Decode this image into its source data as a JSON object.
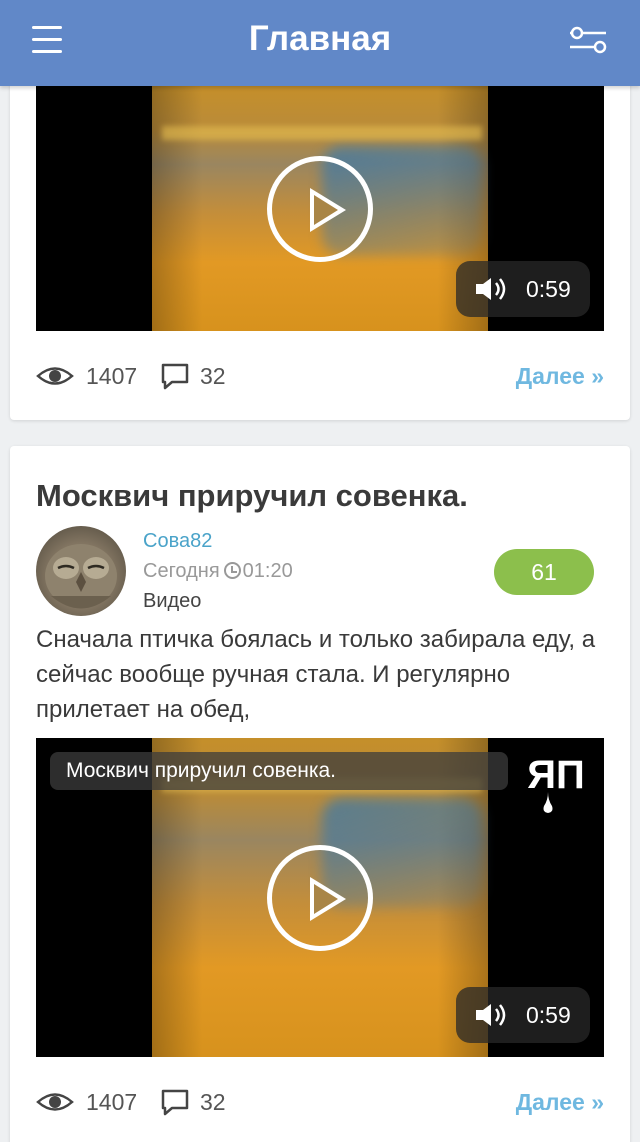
{
  "header": {
    "title": "Главная",
    "menu_icon": "menu-icon",
    "filter_icon": "filter-sliders-icon",
    "bg_color": "#6188c8"
  },
  "posts": [
    {
      "video": {
        "duration": "0:59"
      },
      "stats": {
        "views": "1407",
        "comments": "32",
        "more_label": "Далее »"
      }
    },
    {
      "title": "Москвич приручил совенка.",
      "author": "Сова82",
      "date": "Сегодня",
      "time": "01:20",
      "category": "Видео",
      "rating": "61",
      "text": "Сначала птичка боялась и только забирала еду, а сейчас вообще ручная стала. И регулярно прилетает на обед,",
      "video": {
        "overlay_title": "Москвич приручил совенка.",
        "brand": "ЯП",
        "duration": "0:59"
      },
      "stats": {
        "views": "1407",
        "comments": "32",
        "more_label": "Далее »"
      }
    }
  ],
  "colors": {
    "link": "#4aa3c9",
    "more": "#6fb8e0",
    "rating_bg": "#8cbf4c"
  }
}
